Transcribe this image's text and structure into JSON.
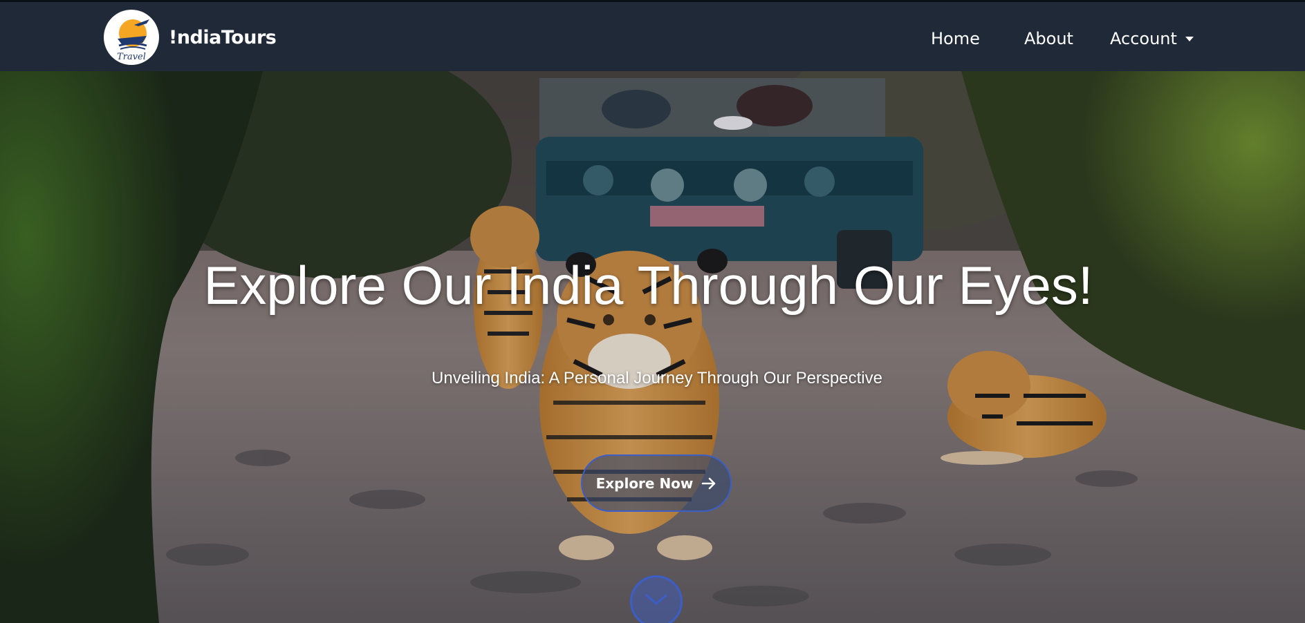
{
  "navbar": {
    "brand_name": "!ndiaTours",
    "logo_text": "Travel",
    "links": {
      "home": "Home",
      "about": "About",
      "account": "Account"
    }
  },
  "hero": {
    "title": "Explore Our India Through Our Eyes!",
    "subtitle": "Unveiling India: A Personal Journey Through Our Perspective",
    "cta_label": "Explore Now"
  },
  "icons": {
    "logo": "travel-logo-icon",
    "account_caret": "caret-down-icon",
    "cta_arrow": "arrow-right-icon",
    "scroll": "chevron-down-icon"
  },
  "colors": {
    "navbar_bg": "#1f2937",
    "accent": "#3b5ec7",
    "text": "#ffffff"
  }
}
